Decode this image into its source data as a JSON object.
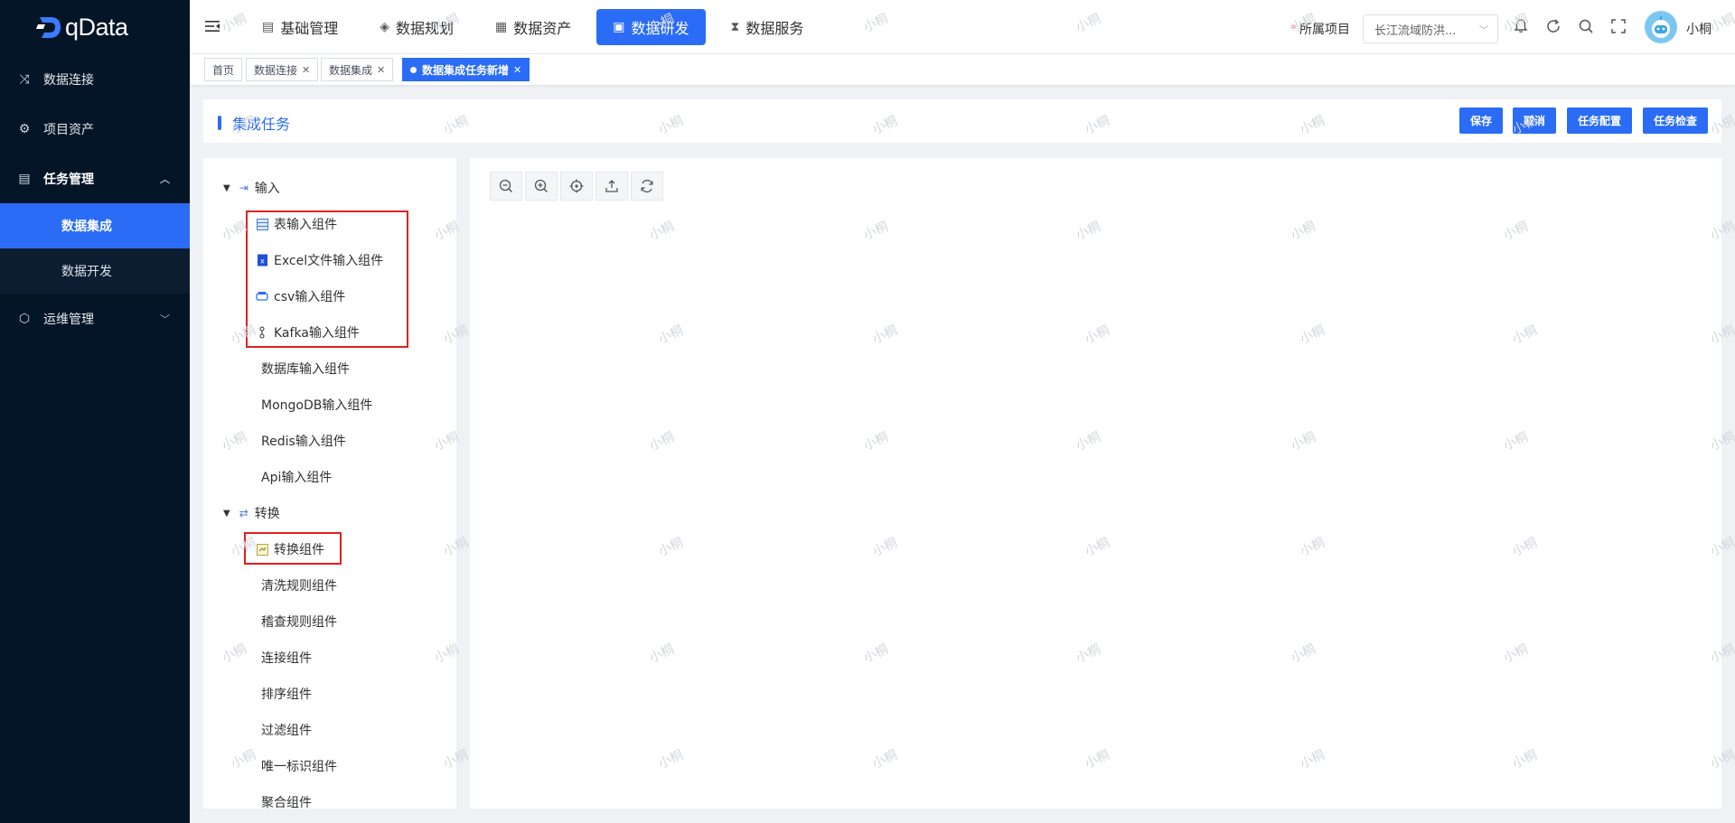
{
  "app": {
    "logo_text": "qData",
    "watermark": "小桐"
  },
  "sidebar": {
    "items": [
      {
        "label": "数据连接",
        "icon": "shuffle-icon"
      },
      {
        "label": "项目资产",
        "icon": "settings-circle-icon"
      },
      {
        "label": "任务管理",
        "icon": "document-icon",
        "expanded": true,
        "children": [
          {
            "label": "数据集成",
            "active": true
          },
          {
            "label": "数据开发",
            "active": false
          }
        ]
      },
      {
        "label": "运维管理",
        "icon": "cube-icon",
        "expanded": false
      }
    ]
  },
  "topnav": {
    "items": [
      {
        "label": "基础管理",
        "icon": "list-icon",
        "active": false
      },
      {
        "label": "数据规划",
        "icon": "layers-icon",
        "active": false
      },
      {
        "label": "数据资产",
        "icon": "assets-icon",
        "active": false
      },
      {
        "label": "数据研发",
        "icon": "window-icon",
        "active": true
      },
      {
        "label": "数据服务",
        "icon": "hourglass-icon",
        "active": false
      }
    ],
    "project_required_mark": "*",
    "project_label": "所属项目",
    "project_value": "长江流域防洪...",
    "username": "小桐"
  },
  "tabs": [
    {
      "label": "首页",
      "closable": false
    },
    {
      "label": "数据连接",
      "closable": true
    },
    {
      "label": "数据集成",
      "closable": true
    },
    {
      "label": "数据集成任务新增",
      "closable": true,
      "active": true
    }
  ],
  "header": {
    "title": "集成任务",
    "buttons": {
      "save": "保存",
      "cancel": "取消",
      "config": "任务配置",
      "check": "任务检查"
    }
  },
  "tree": {
    "groups": [
      {
        "label": "输入",
        "items": [
          {
            "label": "表输入组件",
            "icon": "table-icon"
          },
          {
            "label": "Excel文件输入组件",
            "icon": "excel-icon"
          },
          {
            "label": "csv输入组件",
            "icon": "csv-icon"
          },
          {
            "label": "Kafka输入组件",
            "icon": "kafka-icon"
          },
          {
            "label": "数据库输入组件"
          },
          {
            "label": "MongoDB输入组件"
          },
          {
            "label": "Redis输入组件"
          },
          {
            "label": "Api输入组件"
          }
        ]
      },
      {
        "label": "转换",
        "items": [
          {
            "label": "转换组件",
            "icon": "transform-icon"
          },
          {
            "label": "清洗规则组件"
          },
          {
            "label": "稽查规则组件"
          },
          {
            "label": "连接组件"
          },
          {
            "label": "排序组件"
          },
          {
            "label": "过滤组件"
          },
          {
            "label": "唯一标识组件"
          },
          {
            "label": "聚合组件"
          }
        ]
      }
    ]
  },
  "canvas": {
    "toolbar": [
      "zoom-out-icon",
      "zoom-in-icon",
      "locate-icon",
      "export-icon",
      "refresh-icon"
    ]
  },
  "colors": {
    "primary": "#2a6cf6",
    "sidebar_bg": "#041527",
    "highlight": "#e02020"
  }
}
